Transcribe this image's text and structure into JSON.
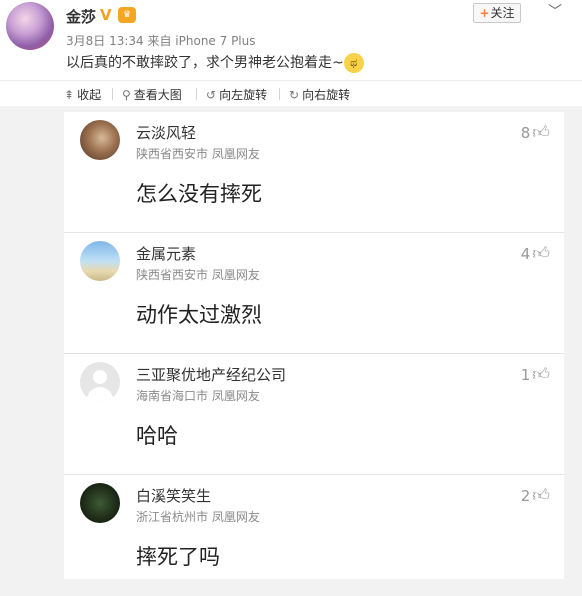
{
  "post": {
    "author": "金莎",
    "verified_mark": "V",
    "level_badge": "vip",
    "follow_label": "关注",
    "follow_plus": "+",
    "menu_icon": "chevron-down-icon",
    "meta": "3月8日 13:34 来自 iPhone 7 Plus",
    "text": "以后真的不敢摔跤了，求个男神老公抱着走~",
    "emoji_icon": "crying-face-emoji"
  },
  "toolbar": {
    "collapse": "收起",
    "view_large": "查看大图",
    "rotate_left": "向左旋转",
    "rotate_right": "向右旋转"
  },
  "comments": [
    {
      "name": "云淡风轻",
      "location": "陕西省西安市  凤凰网友",
      "likes": "8",
      "text": "怎么没有摔死"
    },
    {
      "name": "金属元素",
      "location": "陕西省西安市  凤凰网友",
      "likes": "4",
      "text": "动作太过激烈"
    },
    {
      "name": "三亚聚优地产经纪公司",
      "location": "海南省海口市  凤凰网友",
      "likes": "1",
      "text": "哈哈"
    },
    {
      "name": "白溪笑笑生",
      "location": "浙江省杭州市  凤凰网友",
      "likes": "2",
      "text": "摔死了吗"
    }
  ]
}
